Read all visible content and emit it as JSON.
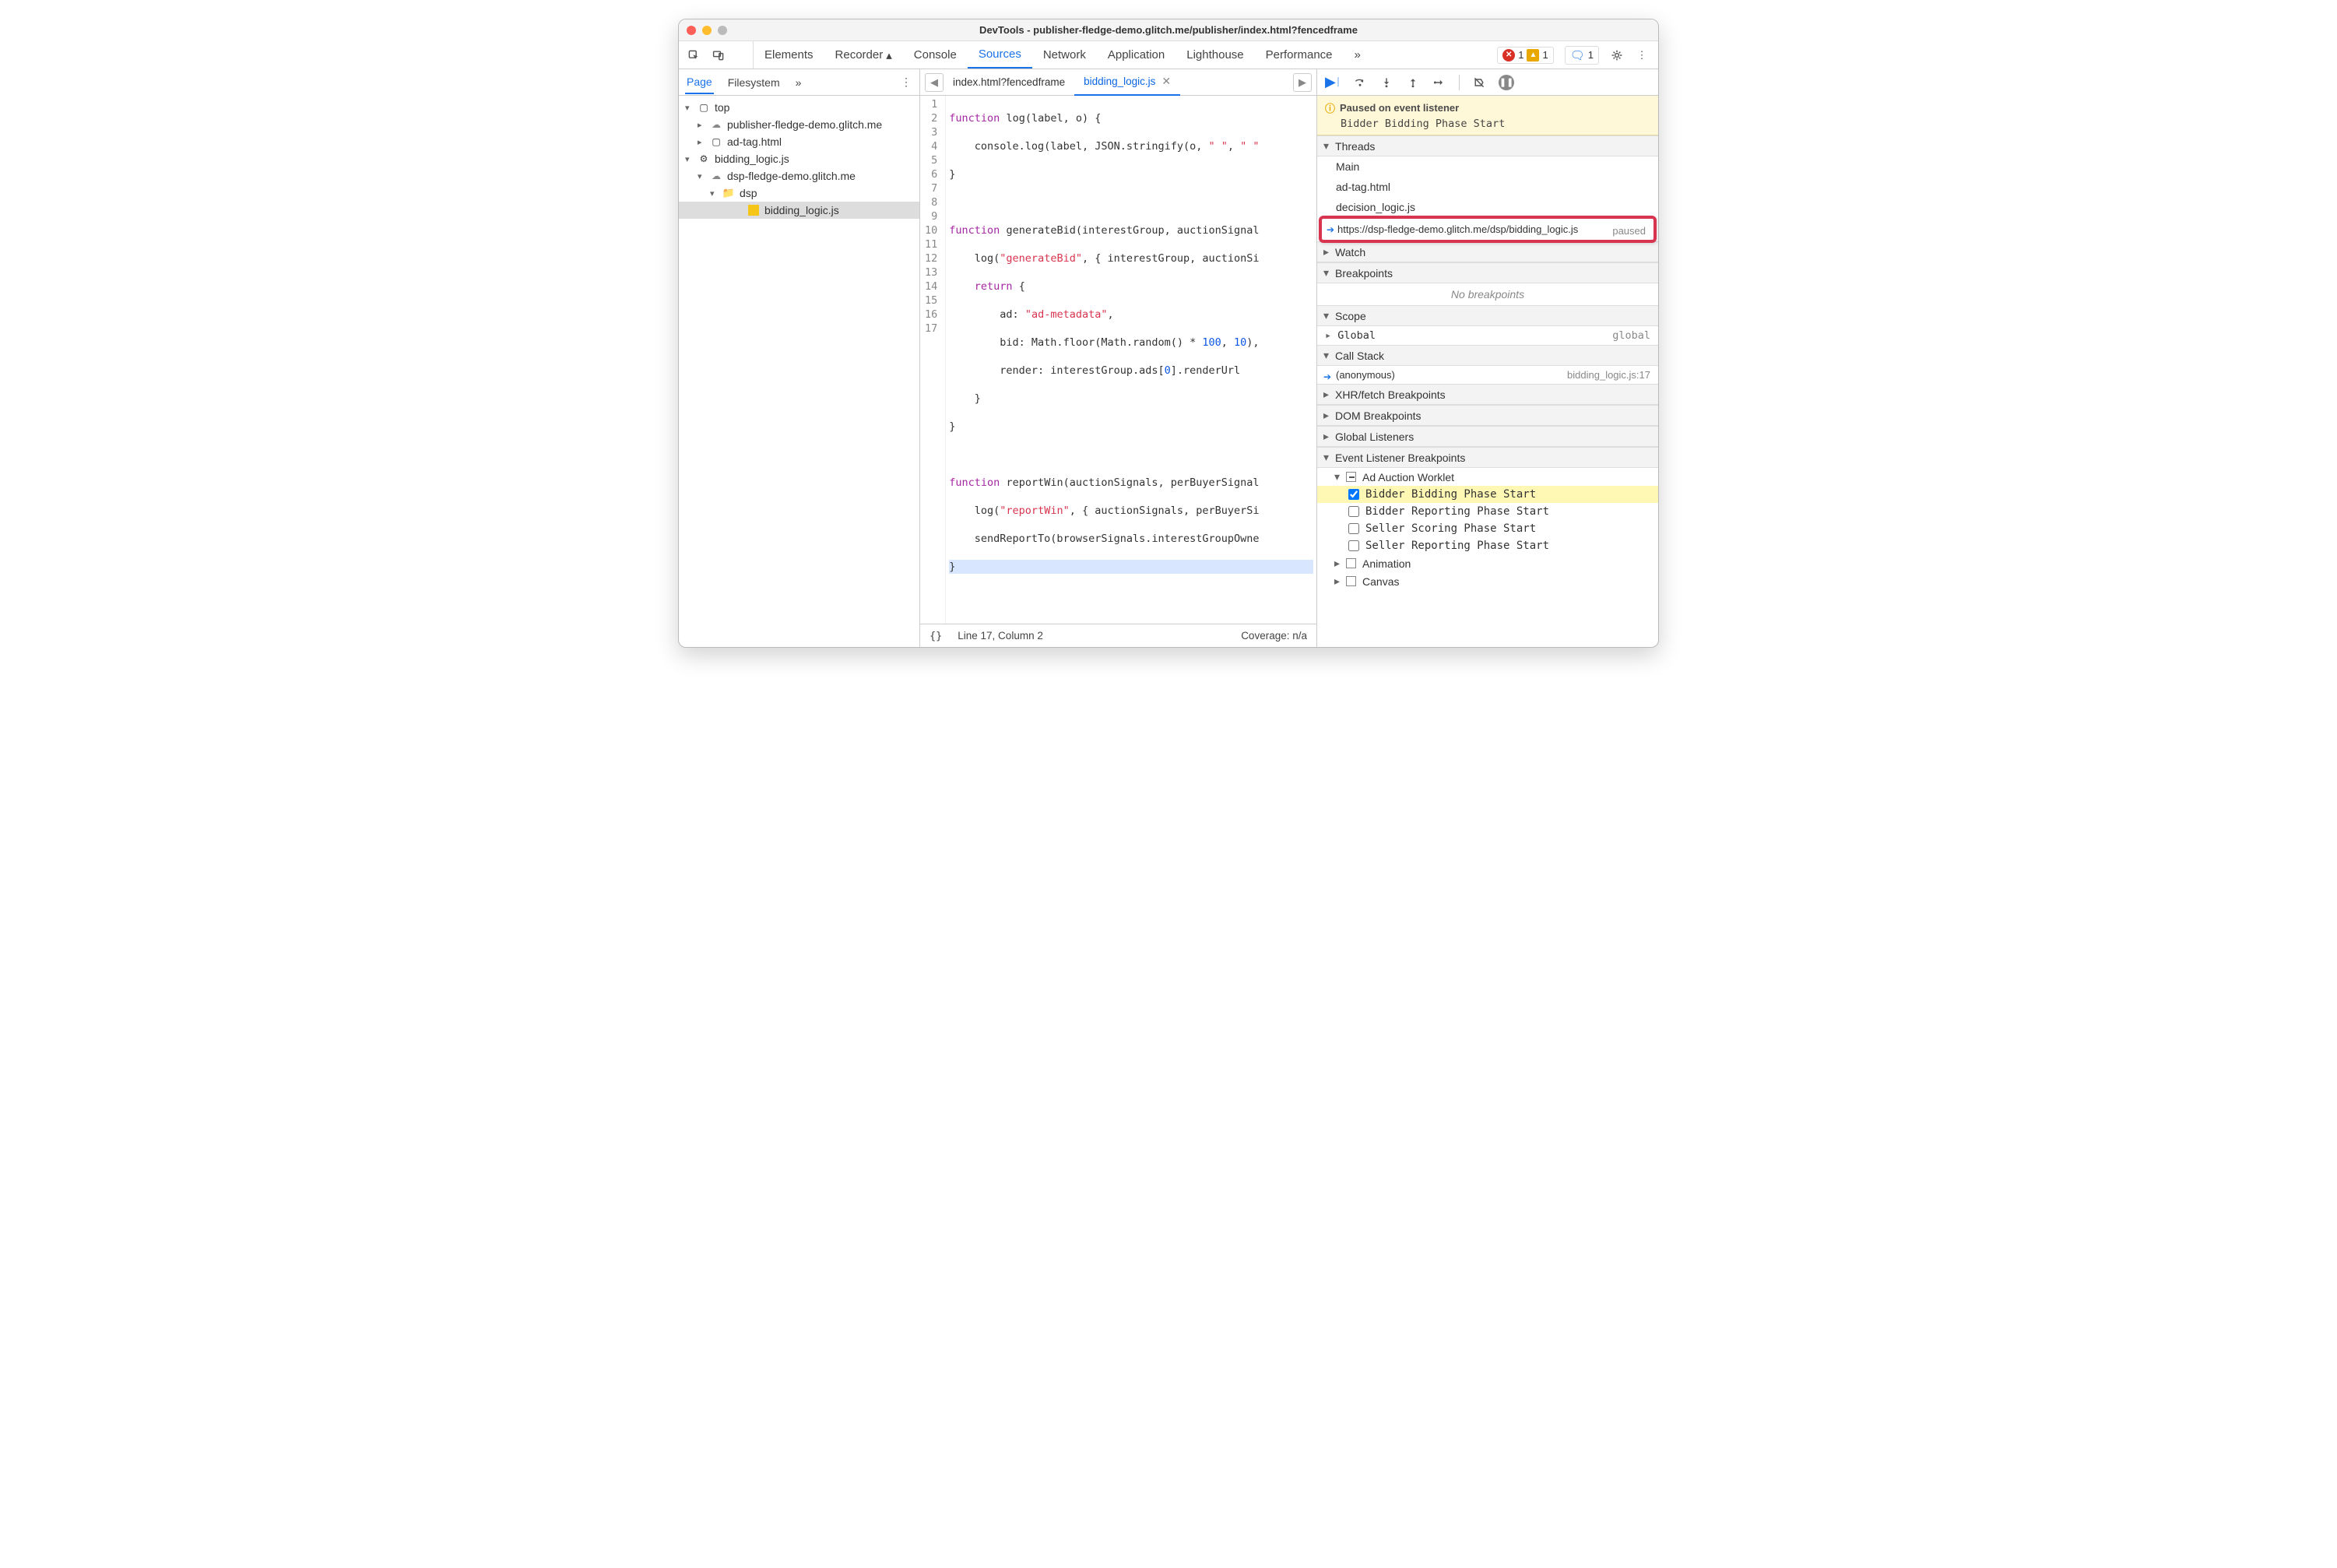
{
  "window": {
    "title": "DevTools - publisher-fledge-demo.glitch.me/publisher/index.html?fencedframe"
  },
  "toolbar": {
    "tabs": [
      "Elements",
      "Recorder",
      "Console",
      "Sources",
      "Network",
      "Application",
      "Lighthouse",
      "Performance"
    ],
    "active": "Sources",
    "errors": "1",
    "warnings": "1",
    "messages": "1"
  },
  "nav": {
    "tabs": [
      "Page",
      "Filesystem"
    ],
    "active": "Page",
    "tree": {
      "top": "top",
      "item1": "publisher-fledge-demo.glitch.me",
      "item2": "ad-tag.html",
      "item3": "bidding_logic.js",
      "item4": "dsp-fledge-demo.glitch.me",
      "item5": "dsp",
      "item6": "bidding_logic.js"
    }
  },
  "editor": {
    "file1": "index.html?fencedframe",
    "file2": "bidding_logic.js",
    "status_loc": "Line 17, Column 2",
    "status_cov": "Coverage: n/a",
    "lines": [
      "function log(label, o) {",
      "    console.log(label, JSON.stringify(o, \" \", \" \"",
      "}",
      "",
      "function generateBid(interestGroup, auctionSignal",
      "    log(\"generateBid\", { interestGroup, auctionSi",
      "    return {",
      "        ad: \"ad-metadata\",",
      "        bid: Math.floor(Math.random() * 100, 10),",
      "        render: interestGroup.ads[0].renderUrl",
      "    }",
      "}",
      "",
      "function reportWin(auctionSignals, perBuyerSignal",
      "    log(\"reportWin\", { auctionSignals, perBuyerSi",
      "    sendReportTo(browserSignals.interestGroupOwne",
      "}"
    ]
  },
  "debug": {
    "pause_title": "Paused on event listener",
    "pause_detail": "Bidder Bidding Phase Start",
    "sections": {
      "threads": "Threads",
      "watch": "Watch",
      "breakpoints": "Breakpoints",
      "scope": "Scope",
      "callstack": "Call Stack",
      "xhr": "XHR/fetch Breakpoints",
      "dom": "DOM Breakpoints",
      "global": "Global Listeners",
      "evbp": "Event Listener Breakpoints"
    },
    "threads": {
      "t1": "Main",
      "t2": "ad-tag.html",
      "t3": "decision_logic.js",
      "t4": "https://dsp-fledge-demo.glitch.me/dsp/bidding_logic.js",
      "t4_state": "paused"
    },
    "no_breakpoints": "No breakpoints",
    "scope": {
      "row_label": "Global",
      "row_value": "global"
    },
    "callstack": {
      "frame": "(anonymous)",
      "loc": "bidding_logic.js:17"
    },
    "ev_cat": "Ad Auction Worklet",
    "ev_items": {
      "i1": "Bidder Bidding Phase Start",
      "i2": "Bidder Reporting Phase Start",
      "i3": "Seller Scoring Phase Start",
      "i4": "Seller Reporting Phase Start"
    },
    "ev_cat2": "Animation",
    "ev_cat3": "Canvas"
  }
}
